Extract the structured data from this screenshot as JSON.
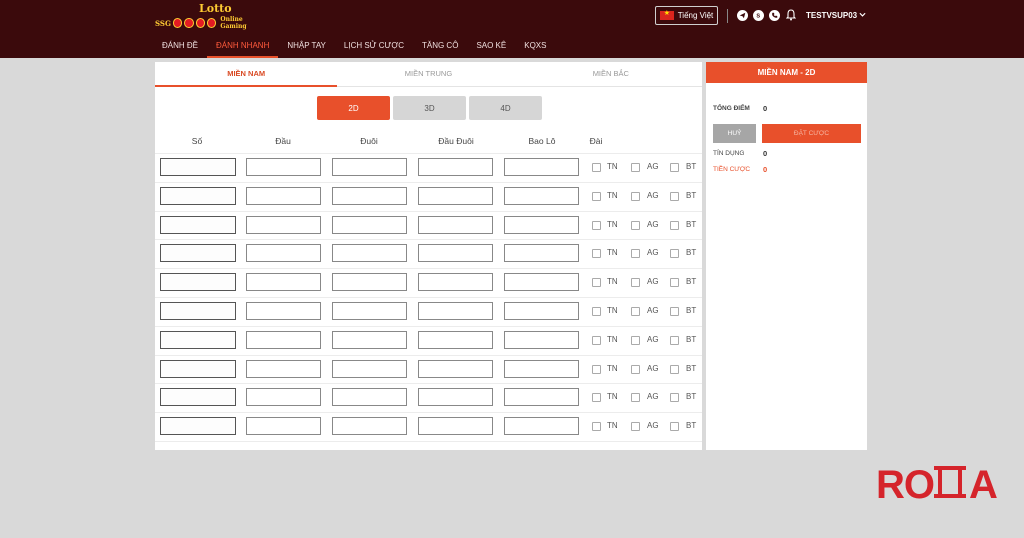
{
  "brand": {
    "logo_top": "Lotto",
    "logo_left": "SSG",
    "logo_right": "Online Gaming",
    "watermark": "ROMA"
  },
  "nav": [
    {
      "label": "ĐÁNH ĐỀ"
    },
    {
      "label": "ĐÁNH NHANH"
    },
    {
      "label": "NHẬP TAY"
    },
    {
      "label": "LỊCH SỬ CƯỢC"
    },
    {
      "label": "TĂNG CÔ"
    },
    {
      "label": "SAO KÊ"
    },
    {
      "label": "KQXS"
    }
  ],
  "nav_active": "ĐÁNH NHANH",
  "header": {
    "language": "Tiếng Việt",
    "username": "TESTVSUP03",
    "icons": [
      "telegram-icon",
      "skype-icon",
      "phone-icon",
      "bell-icon"
    ]
  },
  "region_tabs": [
    "MIỀN NAM",
    "MIỀN TRUNG",
    "MIỀN BẮC"
  ],
  "region_active": "MIỀN NAM",
  "mode_tabs": [
    "2D",
    "3D",
    "4D"
  ],
  "mode_active": "2D",
  "columns": {
    "so": "Số",
    "dau": "Đầu",
    "duoi": "Đuôi",
    "dau_duoi": "Đầu Đuôi",
    "bao_lo": "Bao Lô",
    "dai": "Đài"
  },
  "stations": [
    "TN",
    "AG",
    "BT"
  ],
  "row_count": 10,
  "side": {
    "title": "MIỀN NAM - 2D",
    "total_label": "TỔNG ĐIỂM",
    "total_value": "0",
    "cancel_label": "HUỶ",
    "bet_label": "ĐẶT CƯỢC",
    "credit_label": "TÍN DỤNG",
    "credit_value": "0",
    "bet_money_label": "TIỀN CƯỢC",
    "bet_money_value": "0"
  },
  "colors": {
    "header_bg": "#3b0a0c",
    "accent": "#e8502b",
    "page_bg": "#d9d9d9"
  }
}
